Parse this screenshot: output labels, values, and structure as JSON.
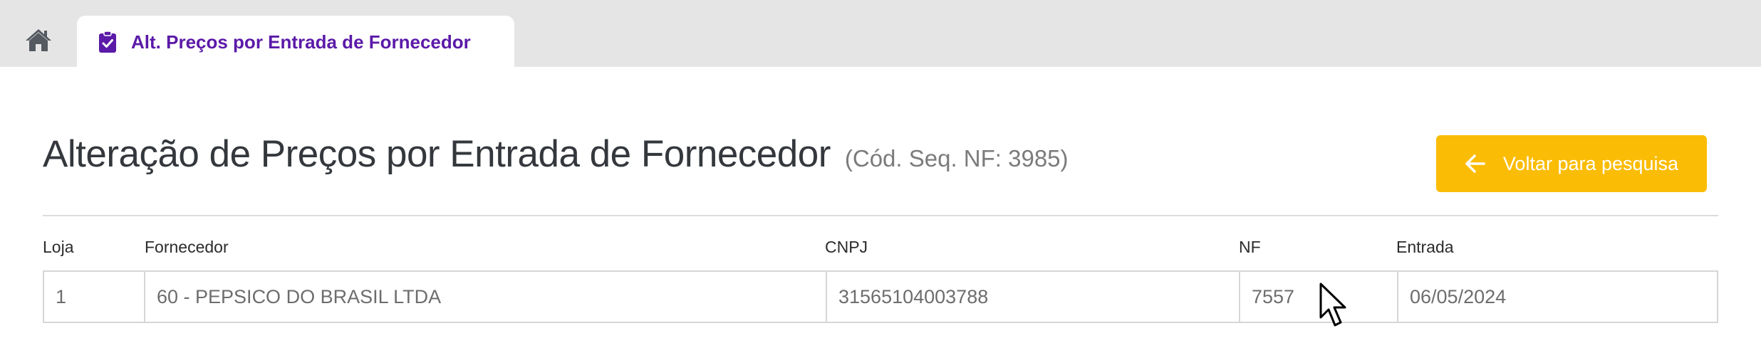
{
  "tabbar": {
    "home_icon": "home-icon",
    "active_tab": {
      "icon": "clipboard-check-icon",
      "label": "Alt. Preços por Entrada de Fornecedor"
    }
  },
  "header": {
    "title": "Alteração de Preços por Entrada de Fornecedor",
    "subtitle": "(Cód. Seq. NF: 3985)",
    "back_button": {
      "icon": "arrow-left-icon",
      "label": "Voltar para pesquisa"
    }
  },
  "info_table": {
    "columns": [
      "Loja",
      "Fornecedor",
      "CNPJ",
      "NF",
      "Entrada"
    ],
    "row": [
      "1",
      "60 - PEPSICO DO BRASIL LTDA",
      "31565104003788",
      "7557",
      "06/05/2024"
    ]
  },
  "colors": {
    "accent_purple": "#5b1aa8",
    "button_yellow": "#fbbc05",
    "tabbar_gray": "#e5e5e5",
    "title_text": "#34383d"
  }
}
